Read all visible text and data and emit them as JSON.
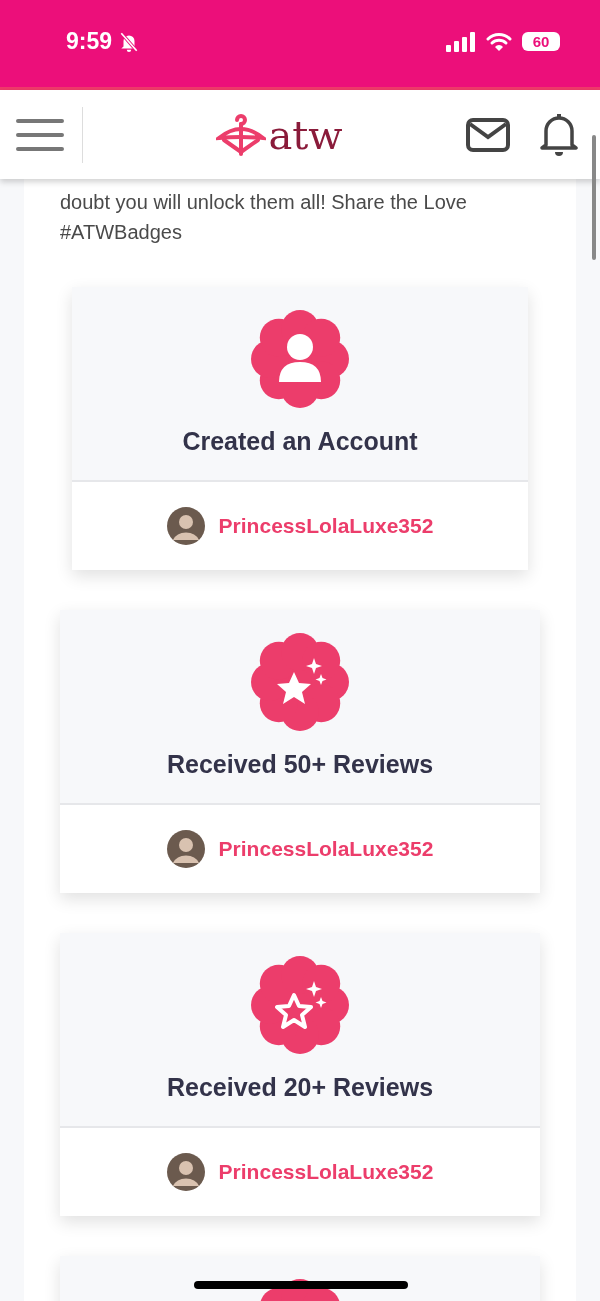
{
  "status_bar": {
    "time": "9:59",
    "silent": true,
    "battery": "60"
  },
  "header": {
    "logo": "atw"
  },
  "intro": "doubt you will unlock them all! Share the Love #ATWBadges",
  "badges": [
    {
      "kind": "account",
      "title": "Created an Account",
      "user": "PrincessLolaLuxe352"
    },
    {
      "kind": "star-filled",
      "title": "Received 50+ Reviews",
      "user": "PrincessLolaLuxe352"
    },
    {
      "kind": "star-outline",
      "title": "Received 20+ Reviews",
      "user": "PrincessLolaLuxe352"
    },
    {
      "kind": "blank"
    }
  ]
}
